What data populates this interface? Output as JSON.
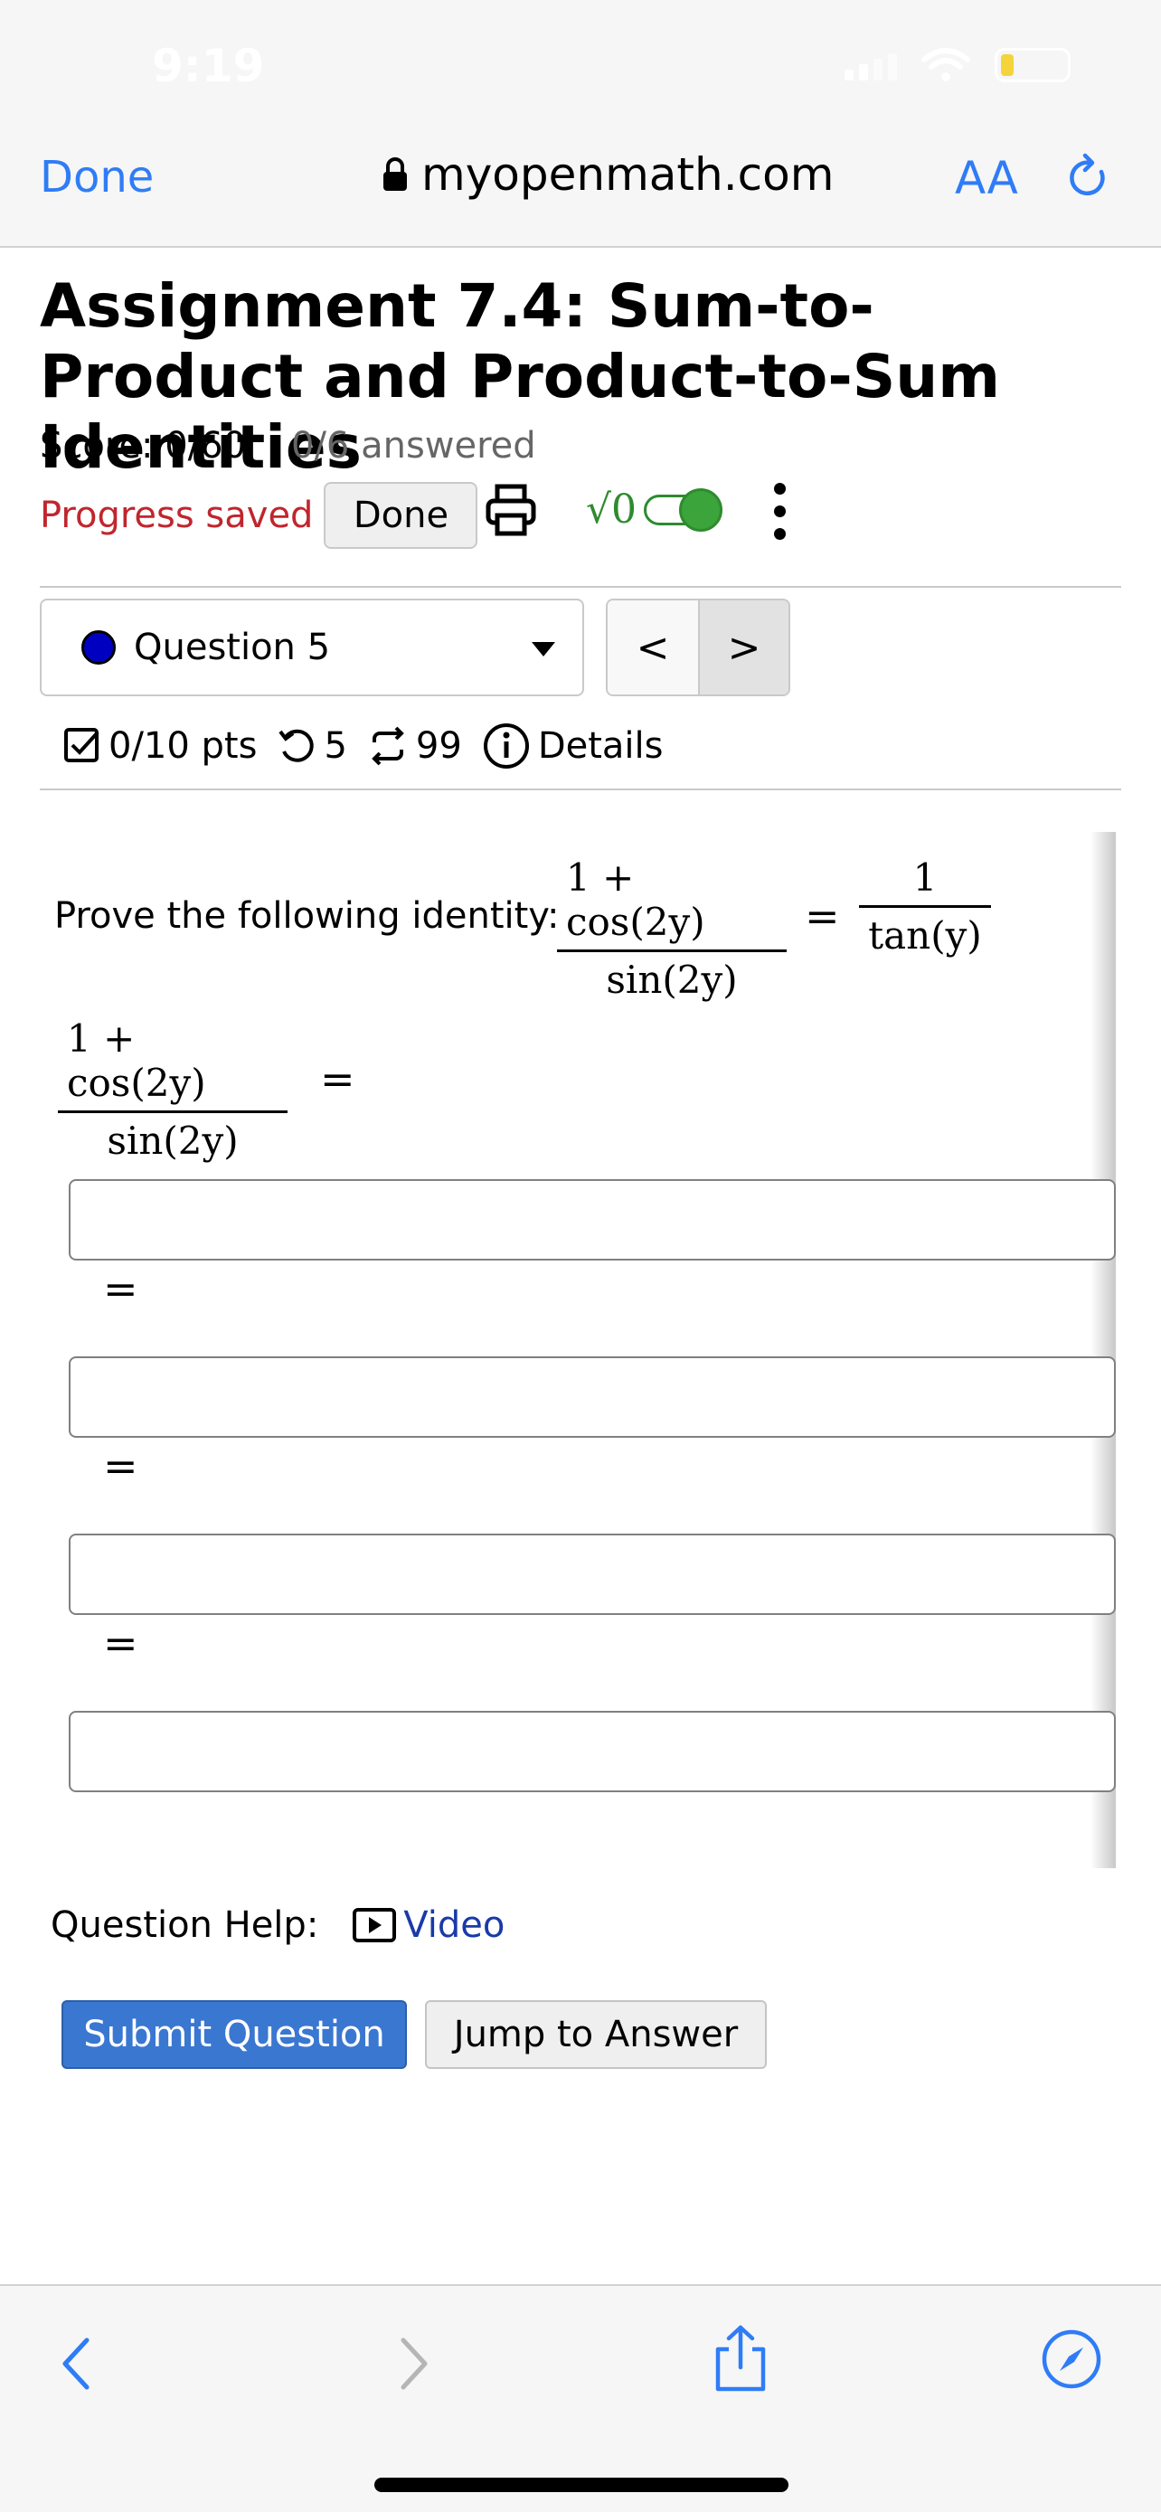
{
  "status": {
    "time": "9:19"
  },
  "browser": {
    "done_label": "Done",
    "domain": "myopenmath.com",
    "text_size_label": "AA",
    "colors": {
      "accent": "#2f7cf6"
    }
  },
  "assignment": {
    "title": "Assignment 7.4: Sum-to-Product and Product-to-Sum Identities",
    "score": "Score: 0/60",
    "answered": "0/6 answered",
    "progress_saved": "Progress saved",
    "done_label": "Done",
    "math_toggle_label": "√0"
  },
  "question_nav": {
    "selected": "Question 5",
    "prev_label": "<",
    "next_label": ">"
  },
  "question_meta": {
    "points": "0/10 pts",
    "retries": "5",
    "attempts": "99",
    "details_label": "Details"
  },
  "question": {
    "prompt": "Prove the following identity:",
    "lhs_numerator": "1 + cos(2y)",
    "lhs_denominator": "sin(2y)",
    "rhs_numerator": "1",
    "rhs_denominator": "tan(y)",
    "equals": "="
  },
  "help": {
    "label": "Question Help:",
    "video_label": "Video"
  },
  "actions": {
    "submit_label": "Submit Question",
    "jump_label": "Jump to Answer"
  },
  "icons": [
    "lock-icon",
    "reload-icon",
    "print-icon",
    "kebab-icon",
    "checkbox-icon",
    "retry-icon",
    "attempts-icon",
    "info-icon",
    "video-icon",
    "back-icon",
    "forward-icon",
    "share-icon",
    "compass-icon"
  ]
}
